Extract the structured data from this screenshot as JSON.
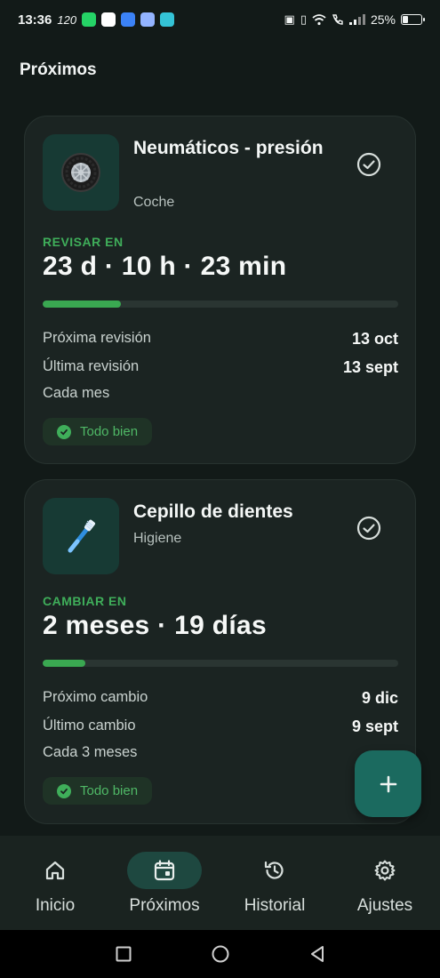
{
  "status_bar": {
    "time": "13:36",
    "refresh": "120",
    "battery": "25%",
    "apps": [
      {
        "icon": "whatsapp-icon",
        "color": "#25d366"
      },
      {
        "icon": "white-app-icon",
        "color": "#ffffff"
      },
      {
        "icon": "mail-app-icon",
        "color": "#3b82f6"
      },
      {
        "icon": "chat-app-icon",
        "color": "#93b4ff"
      },
      {
        "icon": "cloud-app-icon",
        "color": "#34c3d6"
      }
    ]
  },
  "section_title": "Próximos",
  "cards": [
    {
      "icon": "tire-icon",
      "title": "Neumáticos - presión",
      "category": "Coche",
      "label": "REVISAR EN",
      "countdown": "23 d · 10 h · 23 min",
      "progress": 0.22,
      "next_label": "Próxima revisión",
      "next_value": "13 oct",
      "last_label": "Última revisión",
      "last_value": "13 sept",
      "frequency": "Cada mes",
      "badge": "Todo bien"
    },
    {
      "icon": "toothbrush-icon",
      "title": "Cepillo de dientes",
      "category": "Higiene",
      "label": "CAMBIAR EN",
      "countdown": "2 meses · 19 días",
      "progress": 0.12,
      "next_label": "Próximo cambio",
      "next_value": "9 dic",
      "last_label": "Último cambio",
      "last_value": "9 sept",
      "frequency": "Cada 3 meses",
      "badge": "Todo bien"
    }
  ],
  "fab": {
    "icon": "plus-icon"
  },
  "nav": {
    "items": [
      {
        "label": "Inicio",
        "icon": "home-icon",
        "active": false
      },
      {
        "label": "Próximos",
        "icon": "calendar-icon",
        "active": true
      },
      {
        "label": "Historial",
        "icon": "history-icon",
        "active": false
      },
      {
        "label": "Ajustes",
        "icon": "settings-icon",
        "active": false
      }
    ]
  },
  "colors": {
    "background": "#121a18",
    "card": "#1b2422",
    "accent_green": "#3fae5a",
    "fab": "#1b6a5f",
    "active_nav": "#1e4840"
  }
}
